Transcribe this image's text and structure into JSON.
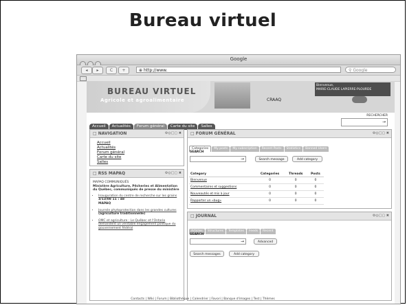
{
  "slide_title": "Bureau virtuel",
  "browser": {
    "window_title": "Google",
    "address": "http://www.",
    "search_placeholder": "Google",
    "nav_back": "◂",
    "nav_forward": "▸",
    "reload": "C",
    "add": "+"
  },
  "banner": {
    "line1": "BUREAU VIRTUEL",
    "line2": "Agricole et agroalimentaire",
    "org": "CRAAQ",
    "welcome_line1": "Bienvenue,",
    "welcome_line2": "MARIE-CLAUDE LAPIERRE-PLOURDE"
  },
  "nav_tabs": [
    "Accueil",
    "Actualités",
    "Forum général",
    "Carte du site",
    "Salles"
  ],
  "search_label": "RECHERCHER",
  "navigation": {
    "title": "NAVIGATION",
    "links": [
      "Accueil",
      "Actualités",
      "Forum général",
      "Carte du site",
      "Salles"
    ]
  },
  "rss": {
    "title": "RSS MAPAQ",
    "source": "MAPAQ COMMUNIQUÉS",
    "description": "Ministère Agriculture, Pêcheries et Alimentation du Québec, communiqués de presse du ministère",
    "items": [
      {
        "text": "Inauguration du centre de recherche sur les grains",
        "date": "3/13/08 11 : 48",
        "org": "MAPAQ"
      },
      {
        "text": "Journée phytoprotection dans les grandes cultures",
        "extra": "(agriculture traditionnelle)"
      },
      {
        "text": "OMC et agriculture : Le Québec et l'Ontario demandent un véritable engagement politique du gouvernement fédéral"
      }
    ]
  },
  "forum": {
    "title": "FORUM GÉNÉRAL",
    "tabs": [
      "Categories",
      "My posts",
      "My subscription",
      "Recent Posts",
      "Statistics",
      "Banned Users"
    ],
    "search_label": "SEARCH",
    "search_button": "Search message",
    "add_button": "Add category",
    "columns": [
      "Category",
      "Categories",
      "Threads",
      "Posts"
    ],
    "rows": [
      {
        "name": "Bienvenue",
        "categories": "0",
        "threads": "0",
        "posts": "0"
      },
      {
        "name": "Commentaires et suggestions",
        "categories": "0",
        "threads": "0",
        "posts": "0"
      },
      {
        "name": "Nouveautés et mis à jour",
        "categories": "0",
        "threads": "0",
        "posts": "0"
      },
      {
        "name": "Rapporter un «bug»",
        "categories": "0",
        "threads": "0",
        "posts": "0"
      }
    ]
  },
  "journal": {
    "title": "JOURNAL",
    "tabs": [
      "Articles",
      "Structures",
      "Templates",
      "Feeds",
      "Recent"
    ],
    "search_label": "SEARCH",
    "advanced_button": "Advanced",
    "search_button": "Search messages",
    "add_button": "Add category"
  },
  "footer": "Contacts | Wiki | Forum | Bibliothèque | Calendrier | Favori | Banque d'images | Test | Thèmes"
}
